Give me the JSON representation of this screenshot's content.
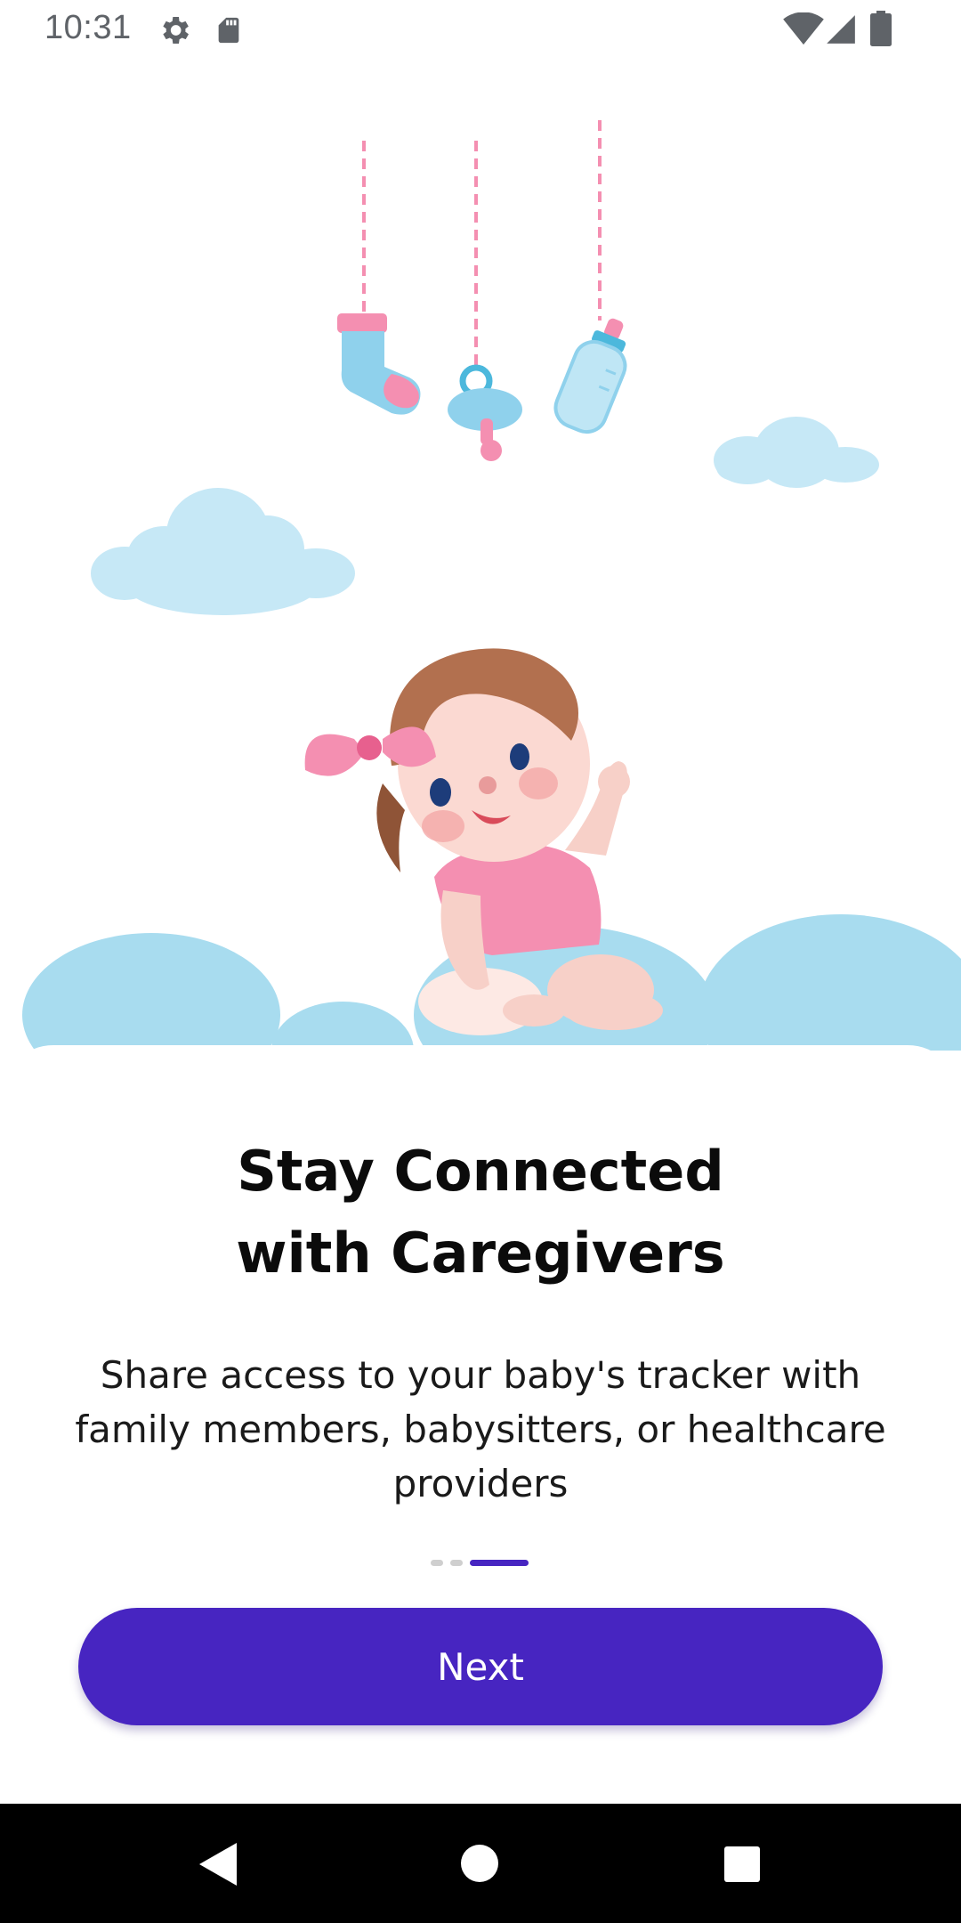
{
  "status_bar": {
    "time": "10:31",
    "icons": [
      "gear-icon",
      "sd-card-icon",
      "wifi-icon",
      "signal-icon",
      "battery-icon"
    ]
  },
  "onboarding": {
    "title_line1": "Stay Connected",
    "title_line2": "with Caregivers",
    "description": "Share access to your baby's tracker with family members, babysitters, or healthcare providers",
    "page_indicator": {
      "total": 3,
      "current": 3
    },
    "next_label": "Next"
  },
  "navigation_bar": {
    "icons": [
      "back-icon",
      "home-icon",
      "recents-icon"
    ]
  },
  "colors": {
    "primary": "#4725c1",
    "title_text": "#0b0b0b",
    "body_text": "#1a1a1a",
    "inactive_dot": "#cfcfcf",
    "cloud": "#a8dcef",
    "baby_pink": "#f48fb1"
  }
}
